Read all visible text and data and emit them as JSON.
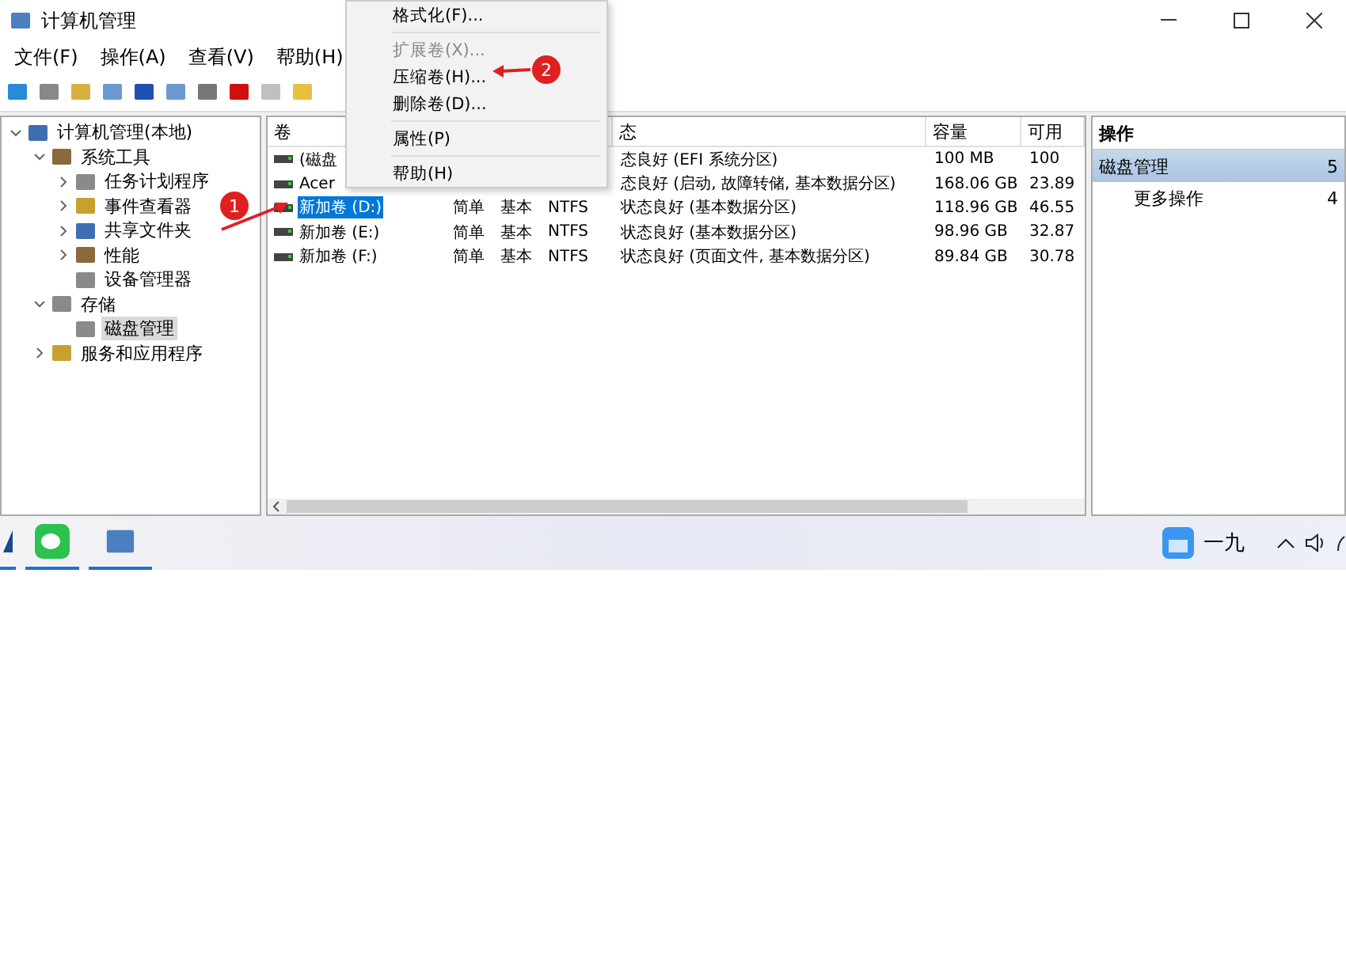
{
  "window": {
    "title": "计算机管理"
  },
  "menu_bar": [
    "文件(F)",
    "操作(A)",
    "查看(V)",
    "帮助(H)"
  ],
  "tree": [
    {
      "label": "计算机管理(本地)",
      "expanded": true,
      "selected": false,
      "children": [
        {
          "label": "系统工具",
          "expanded": true,
          "selected": false,
          "children": [
            {
              "label": "任务计划程序",
              "expanded": false,
              "selected": false
            },
            {
              "label": "事件查看器",
              "expanded": false,
              "selected": false
            },
            {
              "label": "共享文件夹",
              "expanded": false,
              "selected": false
            },
            {
              "label": "性能",
              "expanded": false,
              "selected": false
            },
            {
              "label": "设备管理器",
              "selected": false
            }
          ]
        },
        {
          "label": "存储",
          "expanded": true,
          "selected": false,
          "children": [
            {
              "label": "磁盘管理",
              "selected": true
            }
          ]
        },
        {
          "label": "服务和应用程序",
          "expanded": false,
          "selected": false
        }
      ]
    }
  ],
  "table": {
    "columns": [
      "卷",
      "",
      "",
      "",
      "态",
      "容量",
      "可用"
    ],
    "rows": [
      {
        "selected": false,
        "cells": [
          "(磁盘",
          "",
          "",
          "",
          "态良好 (EFI 系统分区)",
          "100 MB",
          "100"
        ]
      },
      {
        "selected": false,
        "cells": [
          "Acer",
          "",
          "",
          "",
          "态良好 (启动, 故障转储, 基本数据分区)",
          "168.06 GB",
          "23.89"
        ]
      },
      {
        "selected": true,
        "cells": [
          "新加卷 (D:)",
          "简单",
          "基本",
          "NTFS",
          "状态良好 (基本数据分区)",
          "118.96 GB",
          "46.55"
        ]
      },
      {
        "selected": false,
        "cells": [
          "新加卷 (E:)",
          "简单",
          "基本",
          "NTFS",
          "状态良好 (基本数据分区)",
          "98.96 GB",
          "32.87"
        ]
      },
      {
        "selected": false,
        "cells": [
          "新加卷 (F:)",
          "简单",
          "基本",
          "NTFS",
          "状态良好 (页面文件, 基本数据分区)",
          "89.84 GB",
          "30.78"
        ]
      }
    ]
  },
  "actions": {
    "title": "操作",
    "items": [
      {
        "label": "磁盘管理",
        "count": "5",
        "selected": true
      },
      {
        "label": "更多操作",
        "count": "4",
        "selected": false
      }
    ]
  },
  "context_menu": [
    {
      "kind": "item",
      "label": "格式化(F)...",
      "disabled": false
    },
    {
      "kind": "separator"
    },
    {
      "kind": "item",
      "label": "扩展卷(X)...",
      "disabled": true
    },
    {
      "kind": "item",
      "label": "压缩卷(H)...",
      "disabled": false
    },
    {
      "kind": "item",
      "label": "删除卷(D)...",
      "disabled": false
    },
    {
      "kind": "separator"
    },
    {
      "kind": "item",
      "label": "属性(P)",
      "disabled": false
    },
    {
      "kind": "separator"
    },
    {
      "kind": "item",
      "label": "帮助(H)",
      "disabled": false
    }
  ],
  "annotations": [
    "1",
    "2"
  ],
  "taskbar": {
    "clock": "一九"
  }
}
